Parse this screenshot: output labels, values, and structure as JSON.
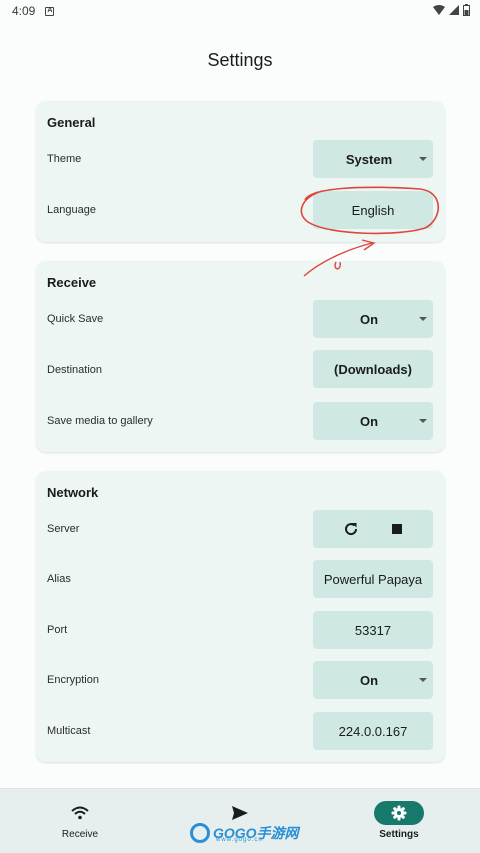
{
  "status_bar": {
    "time": "4:09"
  },
  "page": {
    "title": "Settings"
  },
  "general": {
    "title": "General",
    "theme_label": "Theme",
    "theme_value": "System",
    "language_label": "Language",
    "language_value": "English"
  },
  "receive": {
    "title": "Receive",
    "quick_save_label": "Quick Save",
    "quick_save_value": "On",
    "destination_label": "Destination",
    "destination_value": "(Downloads)",
    "save_media_label": "Save media to gallery",
    "save_media_value": "On"
  },
  "network": {
    "title": "Network",
    "server_label": "Server",
    "alias_label": "Alias",
    "alias_value": "Powerful Papaya",
    "port_label": "Port",
    "port_value": "53317",
    "encryption_label": "Encryption",
    "encryption_value": "On",
    "multicast_label": "Multicast",
    "multicast_value": "224.0.0.167"
  },
  "nav": {
    "receive_label": "Receive",
    "send_label": "Send",
    "settings_label": "Settings",
    "active": "settings",
    "accent_color": "#16796b"
  },
  "watermark": {
    "text": "GOGO手游网",
    "sub": "www.gogo.cn"
  },
  "icons": {
    "wifi": "wifi-icon",
    "send": "send-icon",
    "settings": "gear-icon",
    "refresh": "refresh-icon",
    "stop": "stop-icon"
  }
}
